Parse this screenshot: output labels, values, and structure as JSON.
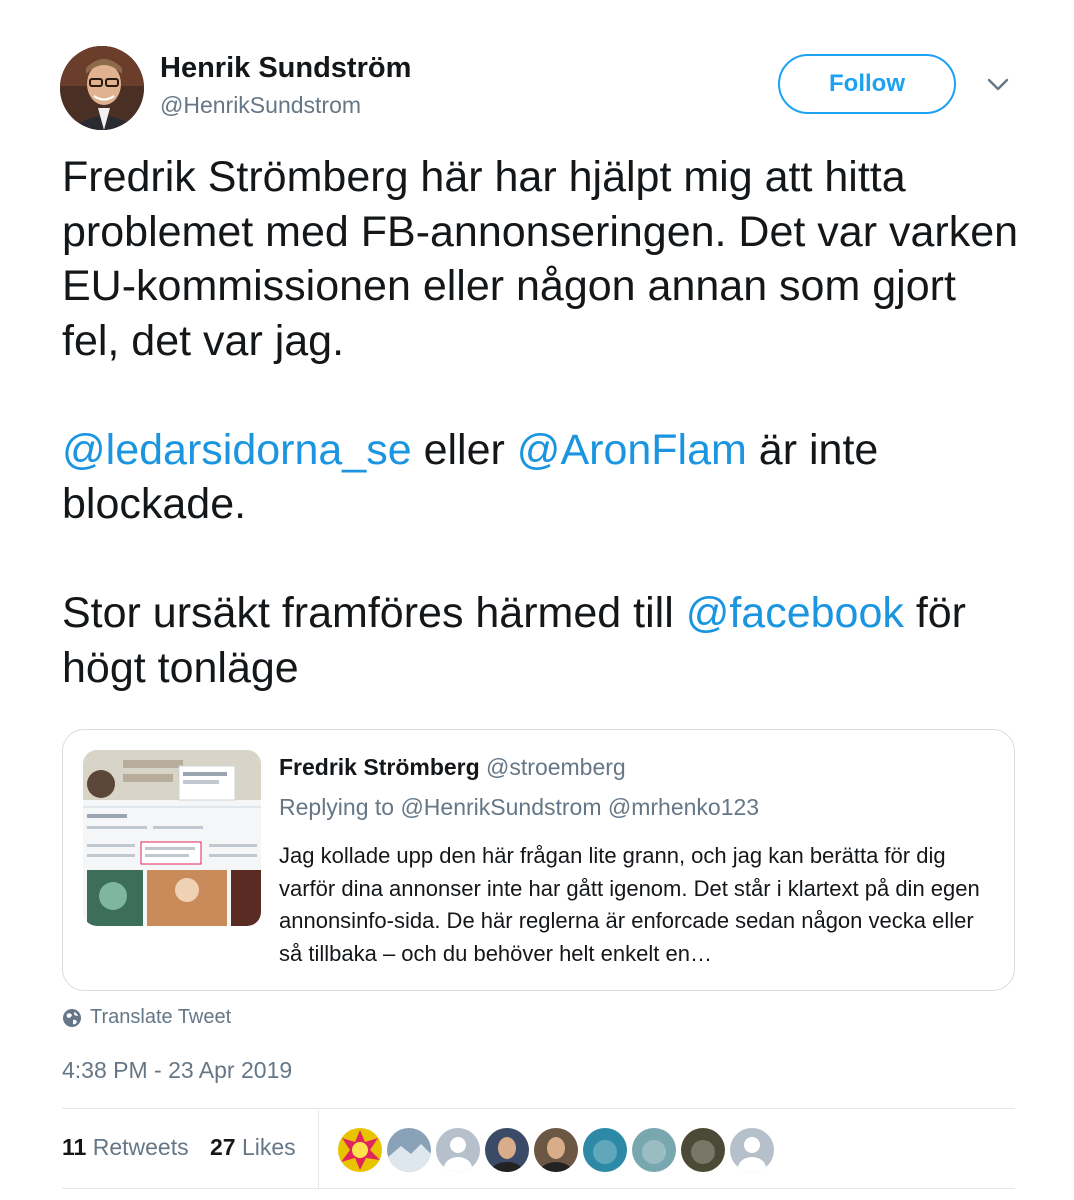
{
  "author": {
    "name": "Henrik Sundström",
    "handle": "@HenrikSundstrom",
    "follow_label": "Follow"
  },
  "tweet": {
    "line1": "Fredrik Strömberg här har hjälpt mig att hitta problemet med FB-annonseringen. Det var varken EU-kommissionen eller någon annan som gjort fel, det var jag.",
    "mention1": "@ledarsidorna_se",
    "mid1": " eller ",
    "mention2": "@AronFlam",
    "mid2": " är inte blockade.",
    "pre3": "Stor ursäkt framföres härmed till ",
    "mention3": "@facebook",
    "post3": " för högt tonläge"
  },
  "quote": {
    "name": "Fredrik Strömberg",
    "handle": "@stroemberg",
    "replying": "Replying to @HenrikSundstrom @mrhenko123",
    "body": "Jag kollade upp den här frågan lite grann, och jag kan berätta för dig varför dina annonser inte har gått igenom. Det står i klartext på din egen annonsinfo-sida. De här reglerna är enforcade sedan någon vecka eller så tillbaka – och du behöver helt enkelt en…"
  },
  "translate_label": "Translate Tweet",
  "timestamp": "4:38 PM - 23 Apr 2019",
  "stats": {
    "retweets_count": "11",
    "retweets_label": "Retweets",
    "likes_count": "27",
    "likes_label": "Likes"
  },
  "likers": [
    {
      "icon": "boom-avatar",
      "color": "#e8c400"
    },
    {
      "icon": "landscape-avatar",
      "color": "#8aa2b8"
    },
    {
      "icon": "default-avatar",
      "color": "#b6c0ca"
    },
    {
      "icon": "portrait-avatar",
      "color": "#3b4a66"
    },
    {
      "icon": "portrait-avatar",
      "color": "#6b5744"
    },
    {
      "icon": "photo-avatar",
      "color": "#2d8aa6"
    },
    {
      "icon": "photo-avatar",
      "color": "#79a7b0"
    },
    {
      "icon": "photo-avatar",
      "color": "#4b4a36"
    },
    {
      "icon": "default-avatar",
      "color": "#b6c0ca"
    }
  ],
  "colors": {
    "accent": "#1da1f2",
    "mention": "#1b95e0",
    "secondary_text": "#657786"
  }
}
